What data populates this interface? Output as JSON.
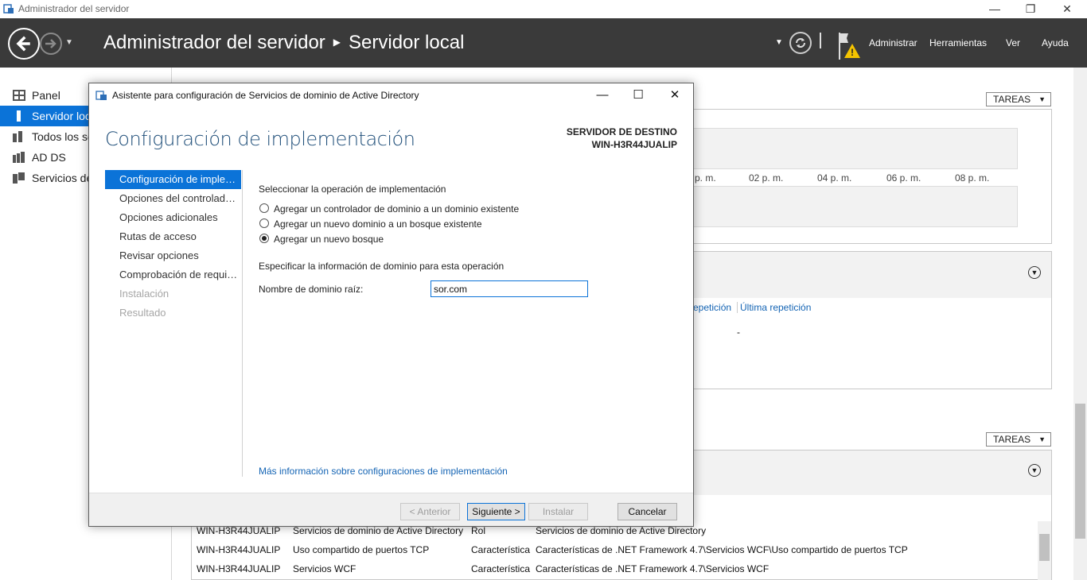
{
  "window": {
    "title": "Administrador del servidor",
    "controls": {
      "minimize": "—",
      "restore": "❐",
      "close": "✕"
    }
  },
  "header": {
    "breadcrumb_root": "Administrador del servidor",
    "breadcrumb_current": "Servidor local",
    "menu": [
      "Administrar",
      "Herramientas",
      "Ver",
      "Ayuda"
    ]
  },
  "sidebar": {
    "items": [
      {
        "label": "Panel",
        "icon": "dashboard-icon"
      },
      {
        "label": "Servidor local",
        "icon": "server-icon",
        "active": true
      },
      {
        "label": "Todos los servidores",
        "icon": "servers-icon"
      },
      {
        "label": "AD DS",
        "icon": "ad-ds-icon"
      },
      {
        "label": "Servicios de archivos y de almacenamiento",
        "icon": "file-services-icon"
      }
    ]
  },
  "background": {
    "tasks_label": "TAREAS",
    "time_ticks": [
      "p. m.",
      "02 p. m.",
      "04 p. m.",
      "06 p. m.",
      "08 p. m."
    ],
    "col_repeat": "epetición",
    "col_last_repeat": "Última repetición",
    "dash": "-",
    "rows": [
      [
        "WIN-H3R44JUALIP",
        "Servicios de dominio de Active Directory",
        "Rol",
        "Servicios de dominio de Active Directory"
      ],
      [
        "WIN-H3R44JUALIP",
        "Uso compartido de puertos TCP",
        "Característica",
        "Características de .NET Framework 4.7\\Servicios WCF\\Uso compartido de puertos TCP"
      ],
      [
        "WIN-H3R44JUALIP",
        "Servicios WCF",
        "Característica",
        "Características de .NET Framework 4.7\\Servicios WCF"
      ]
    ]
  },
  "dialog": {
    "title": "Asistente para configuración de Servicios de dominio de Active Directory",
    "heading": "Configuración de implementación",
    "dest_label": "SERVIDOR DE DESTINO",
    "dest_server": "WIN-H3R44JUALIP",
    "steps": [
      {
        "label": "Configuración de implementación",
        "state": "active"
      },
      {
        "label": "Opciones del controlador de dominio",
        "state": "normal"
      },
      {
        "label": "Opciones adicionales",
        "state": "normal"
      },
      {
        "label": "Rutas de acceso",
        "state": "normal"
      },
      {
        "label": "Revisar opciones",
        "state": "normal"
      },
      {
        "label": "Comprobación de requisitos previos",
        "state": "normal"
      },
      {
        "label": "Instalación",
        "state": "disabled"
      },
      {
        "label": "Resultado",
        "state": "disabled"
      }
    ],
    "operation_label": "Seleccionar la operación de implementación",
    "options": [
      {
        "label": "Agregar un controlador de dominio a un dominio existente",
        "checked": false
      },
      {
        "label": "Agregar un nuevo dominio a un bosque existente",
        "checked": false
      },
      {
        "label": "Agregar un nuevo bosque",
        "checked": true
      }
    ],
    "domain_info_label": "Especificar la información de dominio para esta operación",
    "root_domain_label": "Nombre de dominio raíz:",
    "root_domain_value": "sor.com",
    "more_info_link": "Más información sobre configuraciones de implementación",
    "buttons": {
      "previous": "< Anterior",
      "next": "Siguiente >",
      "install": "Instalar",
      "cancel": "Cancelar"
    }
  },
  "colors": {
    "accent": "#0b73d8",
    "header_bg": "#3a3a3a",
    "heading": "#1f4e79",
    "link": "#1464b4"
  }
}
